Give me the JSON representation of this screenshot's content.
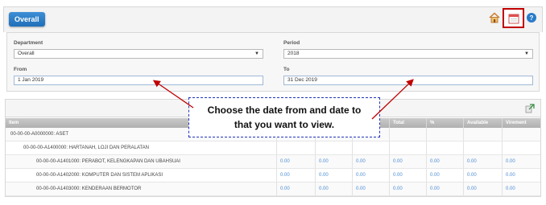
{
  "header": {
    "title": "Overall",
    "icons": [
      "home-icon",
      "calendar-icon",
      "help-icon"
    ]
  },
  "filters": {
    "department_label": "Department",
    "department_value": "Overall",
    "period_label": "Period",
    "period_value": "2018",
    "from_label": "From",
    "from_value": "1 Jan 2019",
    "to_label": "To",
    "to_value": "31 Dec 2019"
  },
  "callout": {
    "line1": "Choose the date from and date to",
    "line2": "that you want to view."
  },
  "grid": {
    "columns": [
      "Item",
      "",
      "",
      "",
      "Total",
      "%",
      "Available",
      "Virement"
    ],
    "rows": [
      {
        "label": "00-00-00-A0000000: ASET",
        "values": [
          "",
          "",
          "",
          "",
          "",
          "",
          ""
        ]
      },
      {
        "label": "00-00-00-A1400000: HARTANAH, LOJI DAN PERALATAN",
        "values": [
          "",
          "",
          "",
          "",
          "",
          "",
          ""
        ]
      },
      {
        "label": "00-00-00-A1401000: PERABOT, KELENGKAPAN DAN UBAHSUAI",
        "values": [
          "0.00",
          "0.00",
          "0.00",
          "0.00",
          "0.00",
          "0.00",
          "0.00"
        ]
      },
      {
        "label": "00-00-00-A1402000: KOMPUTER DAN SISTEM APLIKASI",
        "values": [
          "0.00",
          "0.00",
          "0.00",
          "0.00",
          "0.00",
          "0.00",
          "0.00"
        ]
      },
      {
        "label": "00-00-00-A1403000: KENDERAAN BERMOTOR",
        "values": [
          "0.00",
          "0.00",
          "0.00",
          "0.00",
          "0.00",
          "0.00",
          "0.00"
        ]
      }
    ]
  },
  "colors": {
    "title_tab": "#1f6fb8",
    "highlight_border": "#c00000",
    "callout_border": "#2233bb",
    "arrow": "#c00000",
    "value_text": "#4c8dd4"
  }
}
